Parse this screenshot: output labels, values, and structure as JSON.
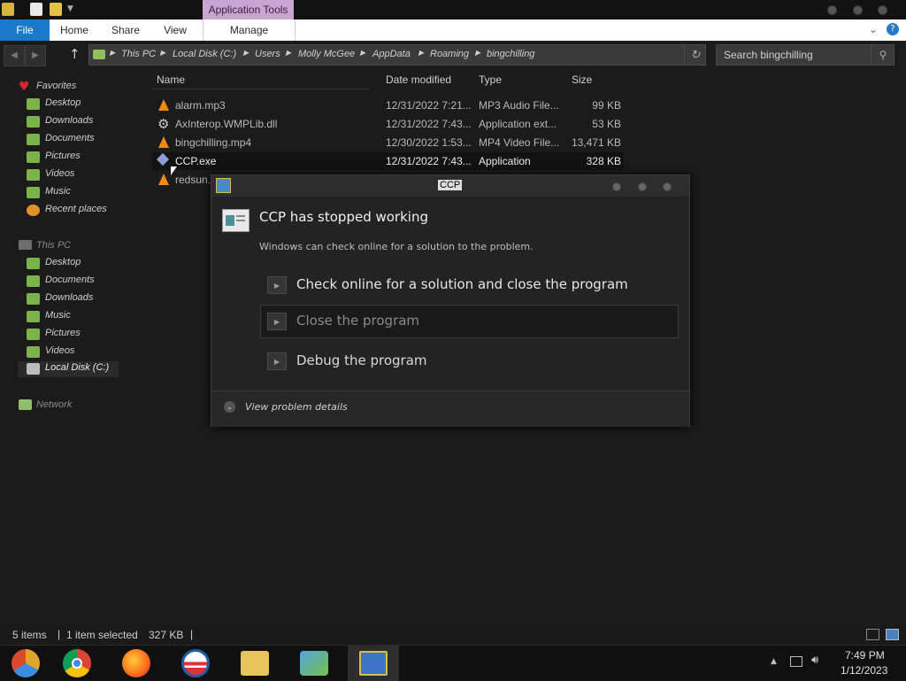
{
  "titlebar": {
    "context_tab": "Application Tools"
  },
  "ribbon": {
    "tabs": [
      "File",
      "Home",
      "Share",
      "View",
      "Manage"
    ]
  },
  "address": {
    "crumbs": [
      "This PC",
      "Local Disk (C:)",
      "Users",
      "Molly McGee",
      "AppData",
      "Roaming",
      "bingchilling"
    ],
    "search_placeholder": "Search bingchilling"
  },
  "sidebar": {
    "favorites_label": "Favorites",
    "favorites": [
      "Desktop",
      "Downloads",
      "Documents",
      "Pictures",
      "Videos",
      "Music",
      "Recent places"
    ],
    "thispc_label": "This PC",
    "thispc": [
      "Desktop",
      "Documents",
      "Downloads",
      "Music",
      "Pictures",
      "Videos",
      "Local Disk (C:)"
    ],
    "network_label": "Network"
  },
  "filelist": {
    "columns": [
      "Name",
      "Date modified",
      "Type",
      "Size"
    ],
    "rows": [
      {
        "name": "alarm.mp3",
        "date": "12/31/2022 7:21...",
        "type": "MP3 Audio File...",
        "size": "99 KB",
        "icon": "vlc-cone-icon"
      },
      {
        "name": "AxInterop.WMPLib.dll",
        "date": "12/31/2022 7:43...",
        "type": "Application ext...",
        "size": "53 KB",
        "icon": "gear-icon"
      },
      {
        "name": "bingchilling.mp4",
        "date": "12/30/2022 1:53...",
        "type": "MP4 Video File...",
        "size": "13,471 KB",
        "icon": "vlc-cone-icon"
      },
      {
        "name": "CCP.exe",
        "date": "12/31/2022 7:43...",
        "type": "Application",
        "size": "328 KB",
        "icon": "exe-icon"
      },
      {
        "name": "redsun.",
        "date": "",
        "type": "",
        "size": "",
        "icon": "vlc-cone-icon"
      }
    ]
  },
  "dialog": {
    "title": "CCP",
    "heading": "CCP has stopped working",
    "message": "Windows can check online for a solution to the problem.",
    "options": [
      "Check online for a solution and close the program",
      "Close the program",
      "Debug the program"
    ],
    "details_label": "View problem details"
  },
  "statusbar": {
    "item_count": "5 items",
    "selection": "1 item selected",
    "selection_size": "327 KB"
  },
  "taskbar": {
    "apps": [
      "chrome-canary-icon",
      "chrome-icon",
      "firefox-icon",
      "obama-logo-icon",
      "file-explorer-icon",
      "network-people-icon",
      "ccp-app-icon"
    ],
    "time": "7:49 PM",
    "date": "1/12/2023"
  },
  "colors": {
    "file_tab": "#1979ca",
    "context_tab": "#c8a6cf",
    "window_bg": "#1b1b1b",
    "vlc_orange": "#f08a14"
  }
}
